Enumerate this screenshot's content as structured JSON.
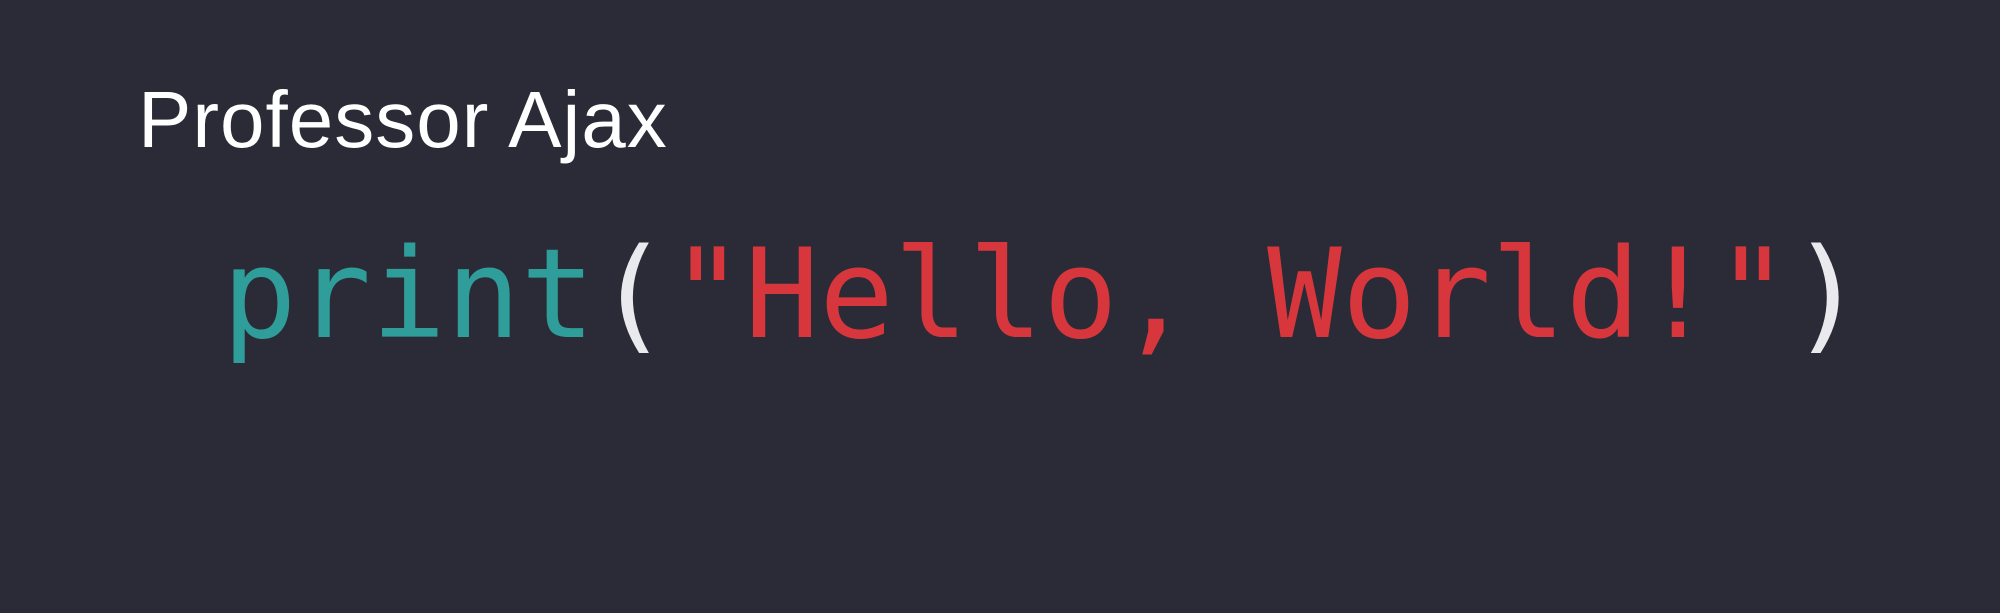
{
  "author": "Professor Ajax",
  "code": {
    "function_name": "print",
    "open_paren": "(",
    "string_literal": "\"Hello, World!\"",
    "close_paren": ")"
  },
  "colors": {
    "background": "#2a2b36",
    "author_text": "#ffffff",
    "function": "#2f9e9a",
    "paren": "#e9e9ee",
    "string": "#d7373c"
  }
}
